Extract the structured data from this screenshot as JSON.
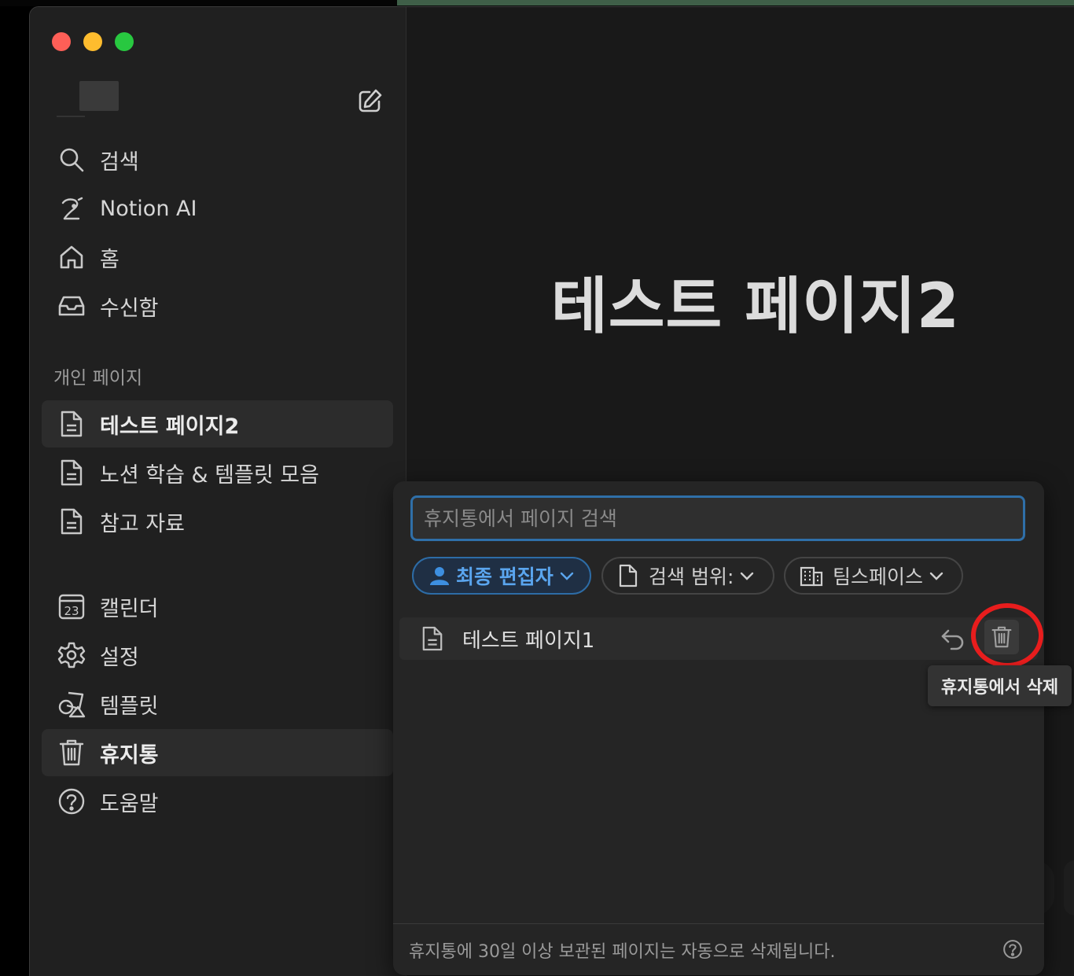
{
  "sidebar": {
    "items": [
      {
        "label": "검색",
        "icon": "search-icon"
      },
      {
        "label": "Notion AI",
        "icon": "notion-ai-icon"
      },
      {
        "label": "홈",
        "icon": "home-icon"
      },
      {
        "label": "수신함",
        "icon": "inbox-icon"
      }
    ],
    "section_label": "개인 페이지",
    "pages": [
      {
        "label": "테스트 페이지2",
        "icon": "page-icon",
        "active": true
      },
      {
        "label": "노션 학습 & 템플릿 모음",
        "icon": "page-icon"
      },
      {
        "label": "참고 자료",
        "icon": "page-icon"
      }
    ],
    "bottom": [
      {
        "label": "캘린더",
        "icon": "calendar-icon",
        "badge": "23"
      },
      {
        "label": "설정",
        "icon": "gear-icon"
      },
      {
        "label": "템플릿",
        "icon": "template-icon"
      },
      {
        "label": "휴지통",
        "icon": "trash-icon",
        "active": true
      },
      {
        "label": "도움말",
        "icon": "help-icon"
      }
    ]
  },
  "main": {
    "title": "테스트 페이지2"
  },
  "trash_panel": {
    "search_placeholder": "휴지통에서 페이지 검색",
    "filters": {
      "last_editor": "최종 편집자",
      "scope": "검색 범위:",
      "teamspace": "팀스페이스"
    },
    "items": [
      {
        "label": "테스트 페이지1",
        "icon": "page-icon"
      }
    ],
    "footer_text": "휴지통에 30일 이상 보관된 페이지는 자동으로 삭제됩니다.",
    "tooltip": "휴지통에서 삭제"
  },
  "colors": {
    "accent": "#2f6fa8",
    "highlight_ring": "#e81d1d"
  }
}
